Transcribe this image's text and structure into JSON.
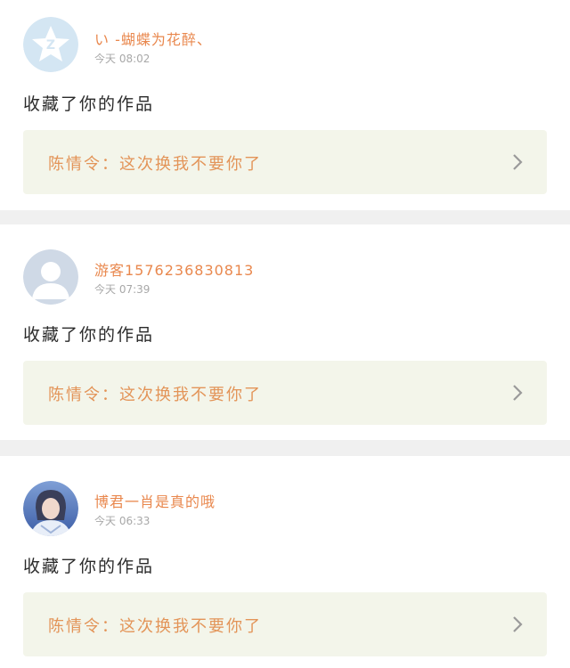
{
  "notifications": [
    {
      "avatar": "qzone-star-avatar",
      "username": "い -蝴蝶为花醉、",
      "time": "今天 08:02",
      "action": "收藏了你的作品",
      "work_title": "陈情令：这次换我不要你了",
      "chevron": "chevron-right-icon"
    },
    {
      "avatar": "default-person-avatar",
      "username": "游客1576236830813",
      "time": "今天 07:39",
      "action": "收藏了你的作品",
      "work_title": "陈情令：这次换我不要你了",
      "chevron": "chevron-right-icon"
    },
    {
      "avatar": "photo-portrait-avatar",
      "username": "博君一肖是真的哦",
      "time": "今天 06:33",
      "action": "收藏了你的作品",
      "work_title": "陈情令：这次换我不要你了",
      "chevron": "chevron-right-icon"
    }
  ],
  "colors": {
    "username": "#e9884e",
    "work_title": "#e39458",
    "work_box_bg": "#f3f5ea",
    "separator": "#f0f0f0"
  }
}
